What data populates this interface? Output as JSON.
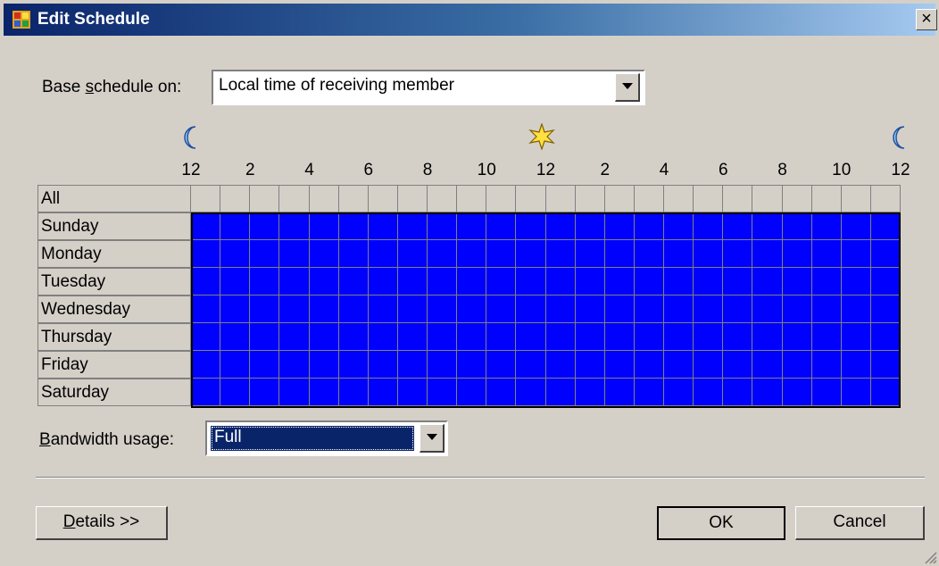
{
  "window": {
    "title": "Edit Schedule",
    "close_glyph": "×",
    "app_icon": "schedule-app-icon"
  },
  "base_schedule": {
    "label_pre": "Base ",
    "label_underlined": "s",
    "label_post": "chedule on:",
    "value": "Local time of receiving member"
  },
  "time_header": {
    "icons": [
      "moon-icon",
      "sun-icon",
      "moon-icon"
    ],
    "hour_labels": [
      "12",
      "2",
      "4",
      "6",
      "8",
      "10",
      "12",
      "2",
      "4",
      "6",
      "8",
      "10",
      "12"
    ]
  },
  "schedule_grid": {
    "all_label": "All",
    "days": [
      "Sunday",
      "Monday",
      "Tuesday",
      "Wednesday",
      "Thursday",
      "Friday",
      "Saturday"
    ],
    "hours_per_day": 24,
    "selected_color": "#0000ff",
    "unselected_color": "#d4d0c8"
  },
  "bandwidth": {
    "label_underlined": "B",
    "label_post": "andwidth usage:",
    "value": "Full",
    "highlight_color": "#0a246a"
  },
  "buttons": {
    "details_underlined": "D",
    "details_post": "etails >>",
    "ok": "OK",
    "cancel": "Cancel"
  }
}
